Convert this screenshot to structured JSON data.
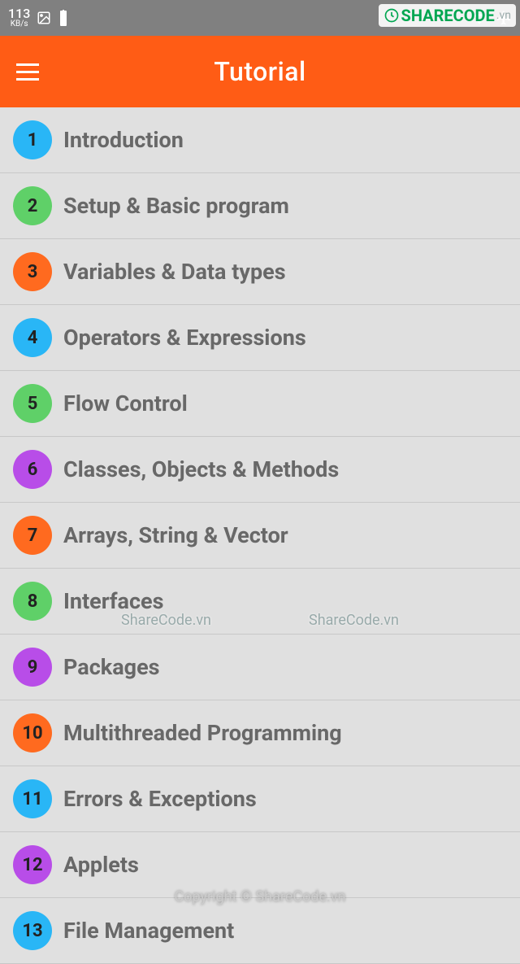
{
  "status_bar": {
    "speed_num": "113",
    "speed_unit": "KB/s"
  },
  "toolbar": {
    "title": "Tutorial"
  },
  "list_items": [
    {
      "num": "1",
      "label": "Introduction",
      "color": "#29b6f6"
    },
    {
      "num": "2",
      "label": "Setup & Basic program",
      "color": "#5fd068"
    },
    {
      "num": "3",
      "label": "Variables & Data types",
      "color": "#ff6a1f"
    },
    {
      "num": "4",
      "label": "Operators & Expressions",
      "color": "#29b6f6"
    },
    {
      "num": "5",
      "label": "Flow Control",
      "color": "#5fd068"
    },
    {
      "num": "6",
      "label": "Classes, Objects & Methods",
      "color": "#b84de8"
    },
    {
      "num": "7",
      "label": "Arrays, String & Vector",
      "color": "#ff6a1f"
    },
    {
      "num": "8",
      "label": "Interfaces",
      "color": "#5fd068"
    },
    {
      "num": "9",
      "label": "Packages",
      "color": "#b84de8"
    },
    {
      "num": "10",
      "label": "Multithreaded Programming",
      "color": "#ff6a1f"
    },
    {
      "num": "11",
      "label": "Errors & Exceptions",
      "color": "#29b6f6"
    },
    {
      "num": "12",
      "label": "Applets",
      "color": "#b84de8"
    },
    {
      "num": "13",
      "label": "File Management",
      "color": "#29b6f6"
    }
  ],
  "watermarks": {
    "top_right_brand": "SHARECODE",
    "top_right_domain": ".vn",
    "mid1": "ShareCode.vn",
    "mid2": "ShareCode.vn",
    "bottom": "Copyright © ShareCode.vn"
  }
}
